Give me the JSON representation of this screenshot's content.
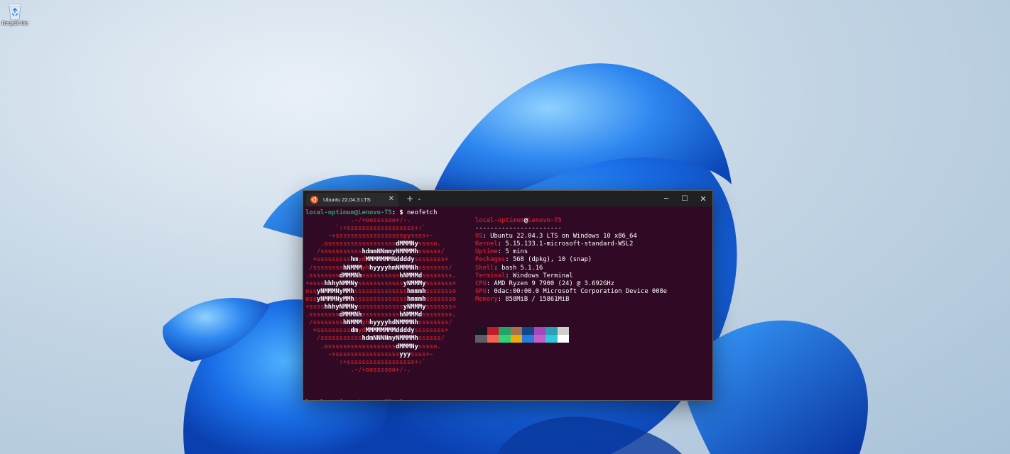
{
  "desktop": {
    "recycle_bin_label": "Recycle Bin"
  },
  "window": {
    "tab_title": "Ubuntu 22.04.3 LTS",
    "tab_close": "✕",
    "new_tab": "+",
    "tab_dropdown": "⌄",
    "minimize": "─",
    "maximize": "☐",
    "close": "✕"
  },
  "terminal": {
    "prompt_user": "local-optimum@Lenovo-T5",
    "prompt_sep": ":",
    "prompt_path": " ",
    "prompt_symbol": "$",
    "command": "neofetch",
    "logo": [
      [
        [
          "r",
          "            .-/+oossssoo+/-.               "
        ]
      ],
      [
        [
          "r",
          "        `:+ssssssssssssssssss+:`           "
        ]
      ],
      [
        [
          "r",
          "      -+ssssssssssssssssssyyssss+-         "
        ]
      ],
      [
        [
          "r",
          "    .ossssssssssssssssss"
        ],
        [
          "w",
          "dMMMNy"
        ],
        [
          "r",
          "sssso.       "
        ]
      ],
      [
        [
          "r",
          "   /sssssssssss"
        ],
        [
          "w",
          "hdmmNNmmyNMMMMh"
        ],
        [
          "r",
          "ssssss/      "
        ]
      ],
      [
        [
          "r",
          "  +sssssssss"
        ],
        [
          "w",
          "hm"
        ],
        [
          "r",
          "yd"
        ],
        [
          "w",
          "MMMMMMMNddddy"
        ],
        [
          "r",
          "ssssssss+     "
        ]
      ],
      [
        [
          "r",
          " /ssssssss"
        ],
        [
          "w",
          "hNMMM"
        ],
        [
          "r",
          "yh"
        ],
        [
          "w",
          "hyyyyhmNMMMNh"
        ],
        [
          "r",
          "ssssssss/    "
        ]
      ],
      [
        [
          "r",
          ".ssssssss"
        ],
        [
          "w",
          "dMMMNh"
        ],
        [
          "r",
          "ssssssssss"
        ],
        [
          "w",
          "hNMMMd"
        ],
        [
          "r",
          "ssssssss.   "
        ]
      ],
      [
        [
          "r",
          "+ssss"
        ],
        [
          "w",
          "hhhyNMMNy"
        ],
        [
          "r",
          "ssssssssssss"
        ],
        [
          "w",
          "yNMMMy"
        ],
        [
          "r",
          "sssssss+   "
        ]
      ],
      [
        [
          "r",
          "oss"
        ],
        [
          "w",
          "yNMMMNyMMh"
        ],
        [
          "r",
          "ssssssssssssss"
        ],
        [
          "w",
          "hmmmh"
        ],
        [
          "r",
          "ssssssso   "
        ]
      ],
      [
        [
          "r",
          "oss"
        ],
        [
          "w",
          "yNMMMNyMMh"
        ],
        [
          "r",
          "ssssssssssssss"
        ],
        [
          "w",
          "hmmmh"
        ],
        [
          "r",
          "ssssssso   "
        ]
      ],
      [
        [
          "r",
          "+ssss"
        ],
        [
          "w",
          "hhhyNMMNy"
        ],
        [
          "r",
          "ssssssssssss"
        ],
        [
          "w",
          "yNMMMy"
        ],
        [
          "r",
          "sssssss+   "
        ]
      ],
      [
        [
          "r",
          ".ssssssss"
        ],
        [
          "w",
          "dMMMNh"
        ],
        [
          "r",
          "ssssssssss"
        ],
        [
          "w",
          "hNMMMd"
        ],
        [
          "r",
          "ssssssss.   "
        ]
      ],
      [
        [
          "r",
          " /ssssssss"
        ],
        [
          "w",
          "hNMMM"
        ],
        [
          "r",
          "yh"
        ],
        [
          "w",
          "hyyyyhdNMMMNh"
        ],
        [
          "r",
          "ssssssss/    "
        ]
      ],
      [
        [
          "r",
          "  +sssssssss"
        ],
        [
          "w",
          "dm"
        ],
        [
          "r",
          "yd"
        ],
        [
          "w",
          "MMMMMMMMddddy"
        ],
        [
          "r",
          "ssssssss+     "
        ]
      ],
      [
        [
          "r",
          "   /sssssssssss"
        ],
        [
          "w",
          "hdmNNNNmyNMMMMh"
        ],
        [
          "r",
          "ssssss/      "
        ]
      ],
      [
        [
          "r",
          "    .ossssssssssssssssss"
        ],
        [
          "w",
          "dMMMNy"
        ],
        [
          "r",
          "sssso.       "
        ]
      ],
      [
        [
          "r",
          "      -+sssssssssssssssss"
        ],
        [
          "w",
          "yyy"
        ],
        [
          "r",
          "ssss+-         "
        ]
      ],
      [
        [
          "r",
          "        `:+ssssssssssssssssss+:`           "
        ]
      ],
      [
        [
          "r",
          "            .-/+oossssoo+/-.               "
        ]
      ]
    ],
    "info_user": "local-optimum",
    "info_at": "@",
    "info_host": "Lenovo-T5",
    "info_separator": "-----------------------",
    "info": [
      {
        "key": "OS",
        "value": "Ubuntu 22.04.3 LTS on Windows 10 x86_64"
      },
      {
        "key": "Kernel",
        "value": "5.15.133.1-microsoft-standard-WSL2"
      },
      {
        "key": "Uptime",
        "value": "5 mins"
      },
      {
        "key": "Packages",
        "value": "568 (dpkg), 10 (snap)"
      },
      {
        "key": "Shell",
        "value": "bash 5.1.16"
      },
      {
        "key": "Terminal",
        "value": "Windows Terminal"
      },
      {
        "key": "CPU",
        "value": "AMD Ryzen 9 7900 (24) @ 3.692GHz"
      },
      {
        "key": "GPU",
        "value": "0dac:00:00.0 Microsoft Corporation Device 008e"
      },
      {
        "key": "Memory",
        "value": "858MiB / 15861MiB"
      }
    ],
    "palette_top": [
      "#171421",
      "#c01c28",
      "#26a269",
      "#a2734c",
      "#12488b",
      "#a347ba",
      "#2aa1b3",
      "#d0cfcc"
    ],
    "palette_bottom": [
      "#5e5c64",
      "#f66151",
      "#33d17a",
      "#e9ad0c",
      "#2a7bde",
      "#c061cb",
      "#33c7de",
      "#ffffff"
    ]
  },
  "colors": {
    "terminal_bg": "#300a24",
    "titlebar_bg": "#202020",
    "prompt_green": "#26a269",
    "ubuntu_red": "#c01c28"
  }
}
